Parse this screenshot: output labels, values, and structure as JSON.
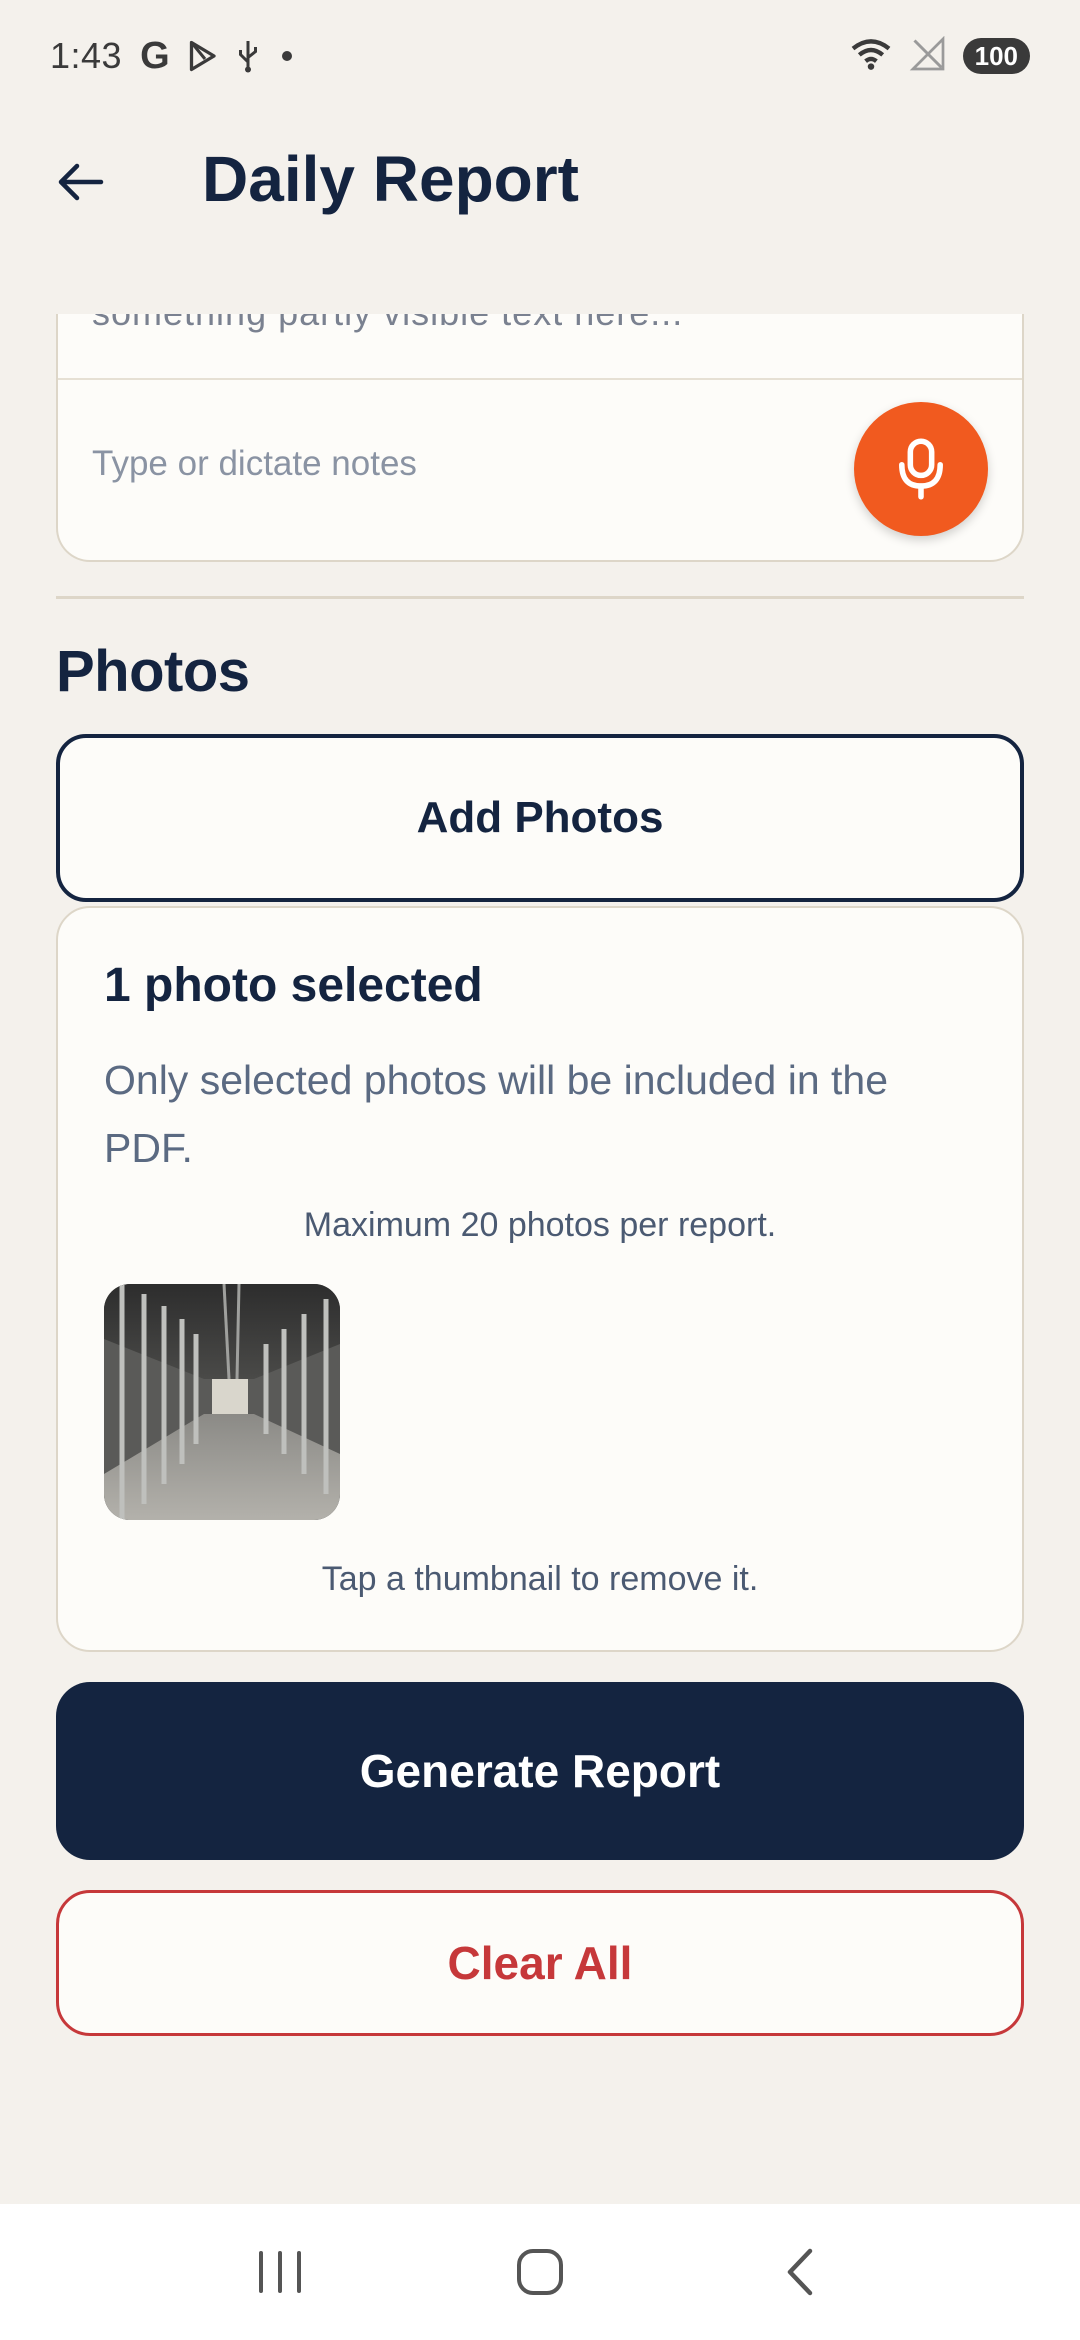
{
  "status_bar": {
    "time": "1:43",
    "battery": "100"
  },
  "app_bar": {
    "title": "Daily Report"
  },
  "notes": {
    "cutoff_text": "something partly visible text here...",
    "placeholder": "Type or dictate notes"
  },
  "photos": {
    "section_title": "Photos",
    "add_button_label": "Add Photos",
    "count_label": "1 photo selected",
    "note": "Only selected photos will be included in the PDF.",
    "max_label": "Maximum 20 photos per report.",
    "hint": "Tap a thumbnail to remove it."
  },
  "actions": {
    "generate_label": "Generate Report",
    "clear_label": "Clear All"
  },
  "colors": {
    "navy": "#142440",
    "accent_orange": "#f15a1f",
    "danger_red": "#c6383a",
    "background": "#f4f1ec"
  }
}
